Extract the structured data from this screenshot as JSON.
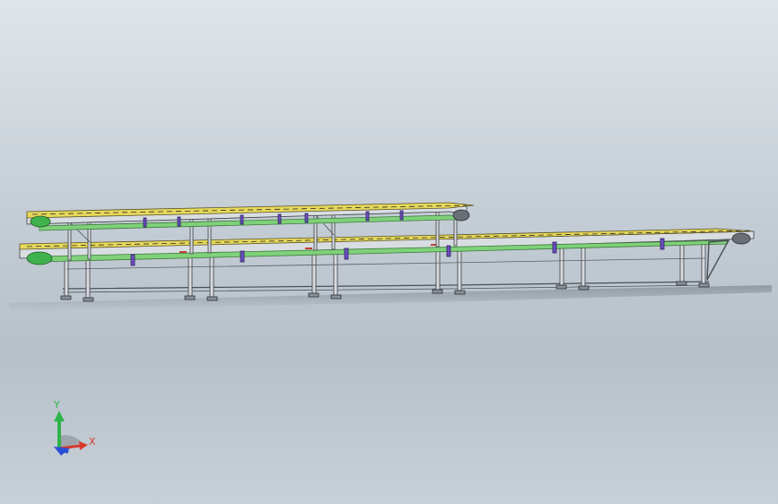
{
  "scene": {
    "description_type": "cad-3d-viewport",
    "colors": {
      "background_top": "#dfe5ea",
      "background_bottom": "#b6c0c9",
      "frame": "#d6dade",
      "frame_edge": "#3b3f44",
      "belt_yellow": "#e6d85a",
      "belt_green": "#7fd17a",
      "roller_green": "#3fb24d",
      "bracket_purple": "#6b4fbf",
      "accent_red": "#c2413a"
    }
  },
  "triad": {
    "y_label": "Y",
    "x_label": "X",
    "colors": {
      "y": "#2eb34a",
      "x": "#d63a2e",
      "z": "#2a4fd6"
    }
  }
}
